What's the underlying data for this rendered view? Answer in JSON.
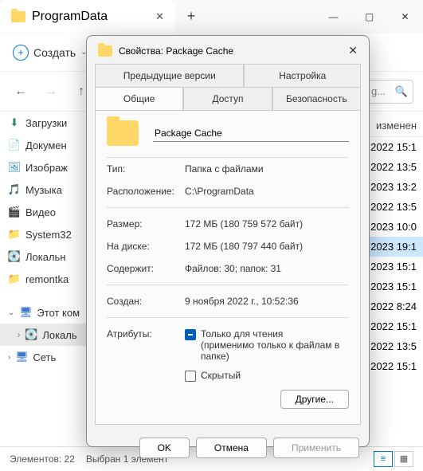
{
  "window": {
    "tab_title": "ProgramData",
    "create_label": "Создать",
    "search_placeholder": "g...",
    "date_header": "изменен"
  },
  "sidebar": {
    "items": [
      {
        "icon": "⬇",
        "label": "Загрузки",
        "color": "#2e8b57"
      },
      {
        "icon": "📄",
        "label": "Докумен",
        "color": "#555"
      },
      {
        "icon": "🖼",
        "label": "Изображ",
        "color": "#2090d0"
      },
      {
        "icon": "🎵",
        "label": "Музыка",
        "color": "#d03a3a"
      },
      {
        "icon": "🎬",
        "label": "Видео",
        "color": "#6a38c0"
      },
      {
        "icon": "📁",
        "label": "System32",
        "color": "#e6b800"
      },
      {
        "icon": "💽",
        "label": "Локальн",
        "color": "#888"
      },
      {
        "icon": "📁",
        "label": "remontka",
        "color": "#e6b800"
      }
    ],
    "this_pc": "Этот ком",
    "local": "Локаль",
    "network": "Сеть"
  },
  "files": {
    "dates": [
      ".2022 15:1",
      ".2022 13:5",
      ".2023 13:2",
      ".2022 13:5",
      ".2023 10:0",
      ".2023 19:1",
      ".2023 15:1",
      ".2023 15:1",
      ".2022 8:24",
      ".2022 15:1",
      ".2022 13:5",
      ".2022 15:1"
    ]
  },
  "status": {
    "count": "Элементов: 22",
    "selection": "Выбран 1 элемент"
  },
  "dialog": {
    "title": "Свойства: Package Cache",
    "tabs_top": [
      "Предыдущие версии",
      "Настройка"
    ],
    "tabs_bottom": [
      "Общие",
      "Доступ",
      "Безопасность"
    ],
    "name_value": "Package Cache",
    "rows": [
      {
        "label": "Тип:",
        "value": "Папка с файлами"
      },
      {
        "label": "Расположение:",
        "value": "C:\\ProgramData"
      },
      {
        "label": "Размер:",
        "value": "172 МБ (180 759 572 байт)"
      },
      {
        "label": "На диске:",
        "value": "172 МБ (180 797 440 байт)"
      },
      {
        "label": "Содержит:",
        "value": "Файлов: 30; папок: 31"
      }
    ],
    "created_label": "Создан:",
    "created_value": "9 ноября 2022 г., 10:52:36",
    "attr_label": "Атрибуты:",
    "readonly_label": "Только для чтения",
    "readonly_sub": "(применимо только к файлам в папке)",
    "hidden_label": "Скрытый",
    "other_btn": "Другие...",
    "ok": "OK",
    "cancel": "Отмена",
    "apply": "Применить"
  }
}
